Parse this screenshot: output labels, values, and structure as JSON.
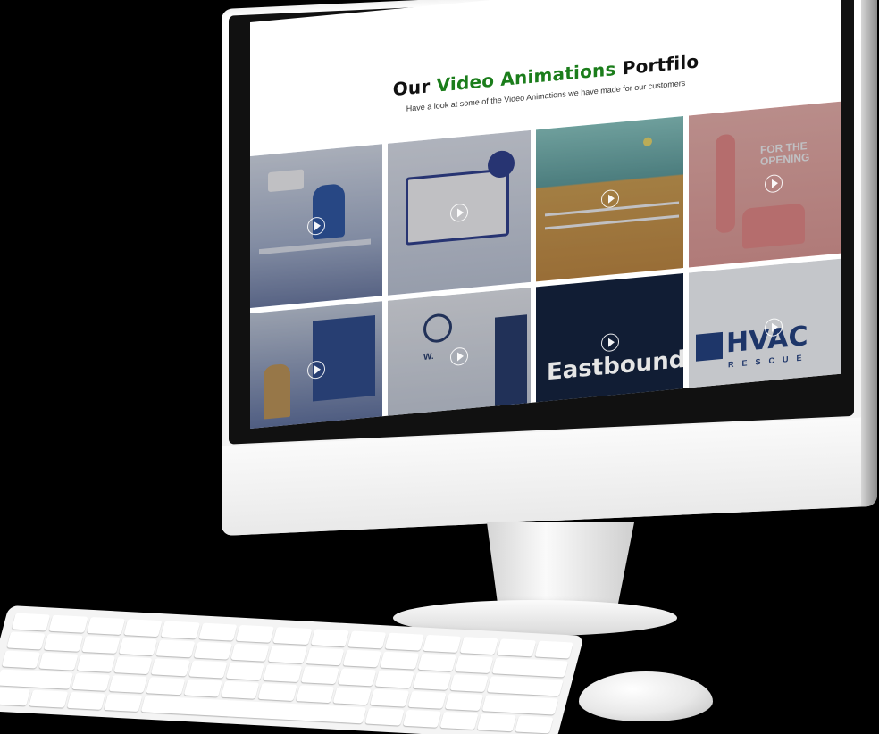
{
  "screen": {
    "title_prefix": "Our",
    "title_accent": "Video Animations",
    "title_suffix": "Portfilo",
    "subtitle": "Have a look at some of the Video Animations we have made for our customers"
  },
  "tiles": [
    {
      "label": "",
      "icon": "play-icon"
    },
    {
      "label": "",
      "icon": "play-icon"
    },
    {
      "label": "",
      "icon": "play-icon"
    },
    {
      "label": "FOR THE OPENING",
      "icon": "play-icon"
    },
    {
      "label": "",
      "icon": "play-icon"
    },
    {
      "label": "W.",
      "icon": "play-icon"
    },
    {
      "label": "Eastbound",
      "icon": "play-icon"
    },
    {
      "label": "HVAC",
      "sublabel": "RESCUE",
      "icon": "play-icon"
    }
  ],
  "colors": {
    "accent": "#1b7d1b",
    "title": "#111111"
  }
}
